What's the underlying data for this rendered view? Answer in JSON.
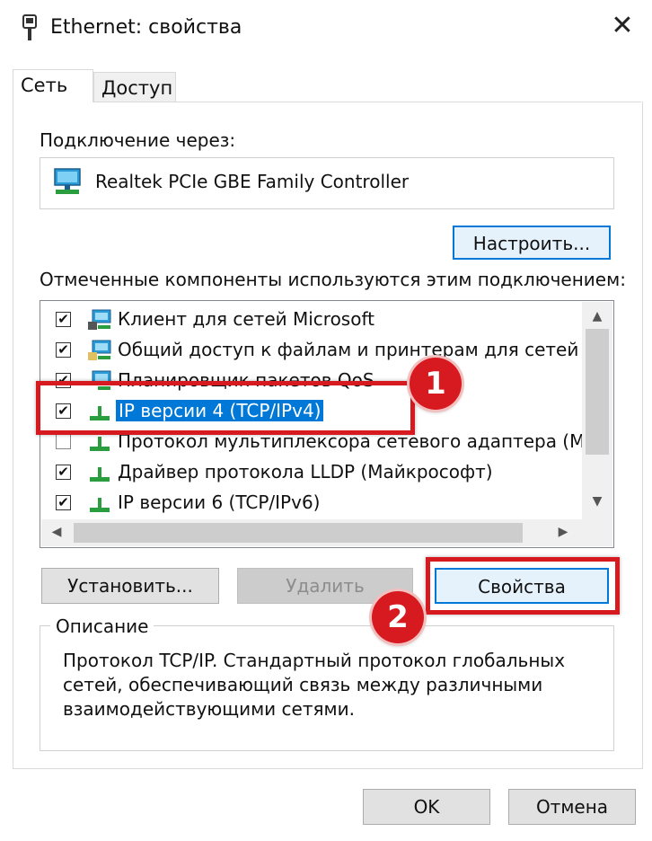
{
  "window": {
    "title": "Ethernet: свойства",
    "close_glyph": "✕"
  },
  "tabs": [
    {
      "label": "Сеть",
      "active": true
    },
    {
      "label": "Доступ",
      "active": false
    }
  ],
  "connect_using": {
    "label": "Подключение через:",
    "adapter": "Realtek PCIe GBE Family Controller",
    "adapter_icon": "network-adapter-icon",
    "configure_button": "Настроить..."
  },
  "components": {
    "label": "Отмеченные компоненты используются этим подключением:",
    "items": [
      {
        "label": "Клиент для сетей Microsoft",
        "checked": true,
        "icon": "network-client-icon"
      },
      {
        "label": "Общий доступ к файлам и принтерам для сетей Mi",
        "checked": true,
        "icon": "file-sharing-icon"
      },
      {
        "label": "Планировщик пакетов QoS",
        "checked": true,
        "icon": "network-service-icon"
      },
      {
        "label": "IP версии 4 (TCP/IPv4)",
        "checked": true,
        "selected": true,
        "icon": "protocol-icon"
      },
      {
        "label": "Протокол мультиплексора сетевого адаптера (Май",
        "checked": false,
        "icon": "protocol-icon"
      },
      {
        "label": "Драйвер протокола LLDP (Майкрософт)",
        "checked": true,
        "icon": "protocol-icon"
      },
      {
        "label": "IP версии 6 (TCP/IPv6)",
        "checked": true,
        "icon": "protocol-icon"
      }
    ],
    "check_glyph": "✔"
  },
  "scroll": {
    "up": "▲",
    "down": "▼",
    "left": "◀",
    "right": "▶"
  },
  "buttons": {
    "install": "Установить...",
    "remove": "Удалить",
    "properties": "Свойства",
    "ok": "OK",
    "cancel": "Отмена"
  },
  "description": {
    "legend": "Описание",
    "text": "Протокол TCP/IP. Стандартный протокол глобальных сетей, обеспечивающий связь между различными взаимодействующими сетями."
  },
  "annotations": {
    "step1": "1",
    "step2": "2",
    "highlight_color": "#d71920"
  },
  "colors": {
    "selection": "#0078d7",
    "focus_border": "#0078d7"
  }
}
